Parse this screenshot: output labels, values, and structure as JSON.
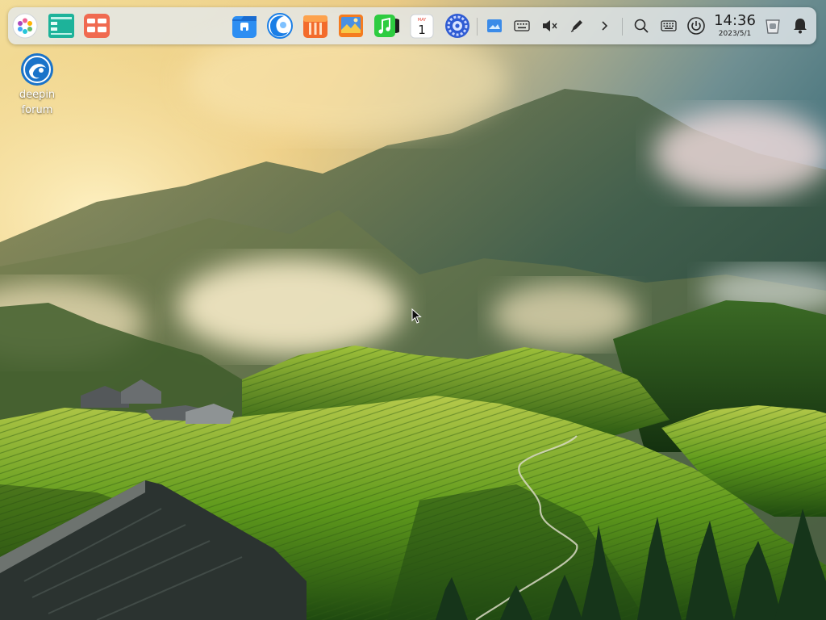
{
  "desktop": {
    "icons": [
      {
        "label_line1": "deepin",
        "label_line2": "forum",
        "icon": "deepin-forum-icon"
      }
    ]
  },
  "dock": {
    "left_items": [
      {
        "name": "launcher",
        "icon": "launcher-icon"
      },
      {
        "name": "multitasking-view",
        "icon": "multitasking-icon"
      },
      {
        "name": "show-desktop",
        "icon": "show-desktop-icon"
      }
    ],
    "apps": [
      {
        "name": "file-manager",
        "icon": "file-manager-icon"
      },
      {
        "name": "browser",
        "icon": "browser-icon"
      },
      {
        "name": "app-store",
        "icon": "app-store-icon"
      },
      {
        "name": "image-viewer",
        "icon": "image-viewer-icon"
      },
      {
        "name": "music",
        "icon": "music-icon"
      },
      {
        "name": "calendar",
        "icon": "calendar-icon",
        "day": "1",
        "month": "MAY"
      },
      {
        "name": "control-center",
        "icon": "control-center-icon"
      }
    ],
    "tray": [
      {
        "name": "screenshot",
        "icon": "screenshot-icon"
      },
      {
        "name": "onboard-keyboard",
        "icon": "onboard-keyboard-icon"
      },
      {
        "name": "volume",
        "icon": "volume-muted-icon"
      },
      {
        "name": "input-method",
        "icon": "pen-icon"
      },
      {
        "name": "expand-tray",
        "icon": "chevron-right-icon"
      },
      {
        "name": "search",
        "icon": "search-icon"
      },
      {
        "name": "keyboard-layout",
        "icon": "keyboard-icon"
      },
      {
        "name": "power",
        "icon": "power-icon"
      }
    ],
    "clock": {
      "time": "14:36",
      "date": "2023/5/1"
    },
    "trash": {
      "icon": "trash-icon"
    },
    "notifications": {
      "icon": "bell-icon"
    }
  },
  "colors": {
    "dock_bg": "#e4e8ec",
    "accent_blue": "#2b7fdb",
    "sky_warm": "#f4d98e",
    "terrace_green": "#6aa322"
  }
}
